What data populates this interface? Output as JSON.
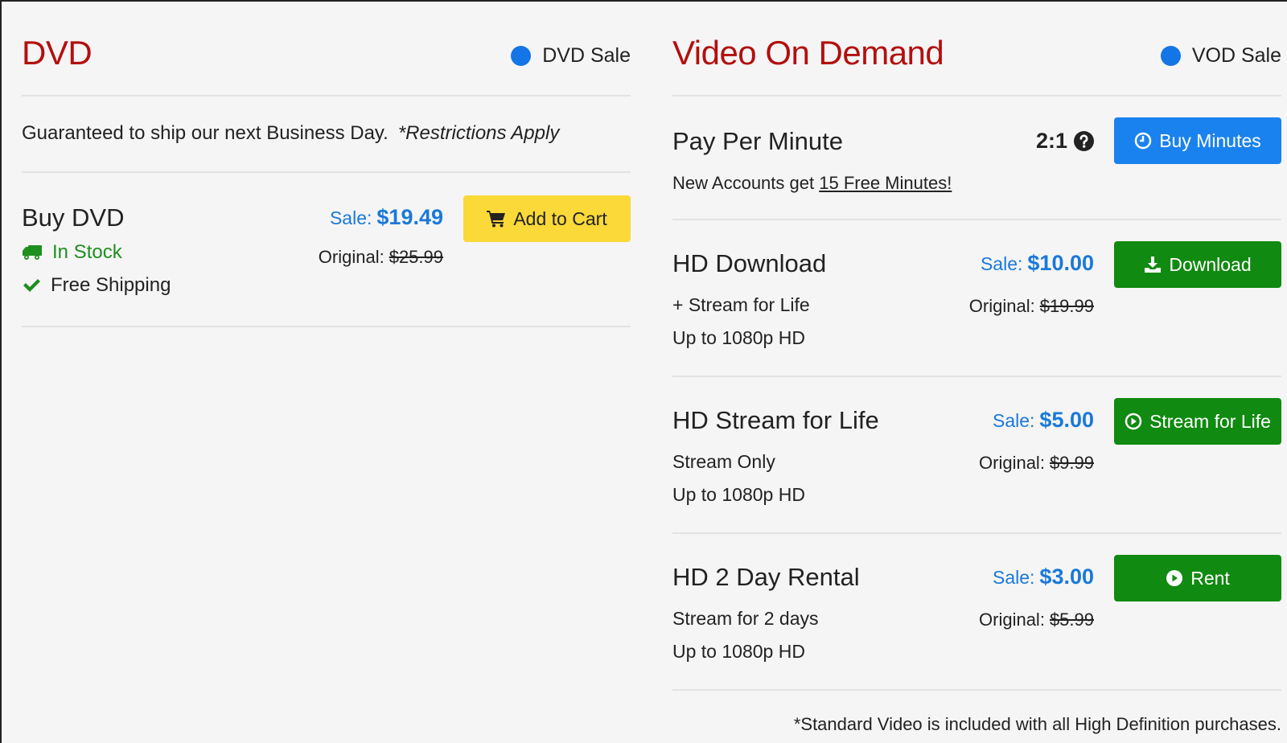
{
  "dvd": {
    "title": "DVD",
    "sale_flag": "DVD Sale",
    "shipping_text": "Guaranteed to ship our next Business Day.",
    "shipping_note": "*Restrictions Apply",
    "buy": {
      "title": "Buy DVD",
      "sale_label": "Sale:",
      "sale_price": "$19.49",
      "original_label": "Original:",
      "original_price": "$25.99",
      "button": "Add to Cart",
      "in_stock": "In Stock",
      "free_shipping": "Free Shipping"
    }
  },
  "vod": {
    "title": "Video On Demand",
    "sale_flag": "VOD Sale",
    "ppm": {
      "title": "Pay Per Minute",
      "ratio": "2:1",
      "button": "Buy Minutes",
      "free_prefix": "New Accounts get",
      "free_link": "15 Free Minutes!"
    },
    "options": [
      {
        "title": "HD Download",
        "line1": "+ Stream for Life",
        "line2": "Up to 1080p HD",
        "sale_label": "Sale:",
        "sale_price": "$10.00",
        "original_label": "Original:",
        "original_price": "$19.99",
        "button": "Download"
      },
      {
        "title": "HD Stream for Life",
        "line1": "Stream Only",
        "line2": "Up to 1080p HD",
        "sale_label": "Sale:",
        "sale_price": "$5.00",
        "original_label": "Original:",
        "original_price": "$9.99",
        "button": "Stream for Life"
      },
      {
        "title": "HD 2 Day Rental",
        "line1": "Stream for 2 days",
        "line2": "Up to 1080p HD",
        "sale_label": "Sale:",
        "sale_price": "$3.00",
        "original_label": "Original:",
        "original_price": "$5.99",
        "button": "Rent"
      }
    ],
    "footnote": "*Standard Video is included with all High Definition purchases."
  },
  "colors": {
    "heading_red": "#b30f0f",
    "sale_blue": "#1a79d8",
    "button_blue": "#1a82ee",
    "button_green": "#108a10",
    "button_yellow": "#fad938",
    "stock_green": "#1f8f1f"
  },
  "icons": {
    "dvd_sale_dot": "blue-dot-icon",
    "vod_sale_dot": "blue-dot-icon",
    "cart": "cart-icon",
    "truck": "truck-icon",
    "check": "check-icon",
    "help": "question-circle-icon",
    "clock": "clock-icon",
    "download": "download-icon",
    "play_outline": "play-circle-outline-icon",
    "play_filled": "play-circle-icon"
  }
}
